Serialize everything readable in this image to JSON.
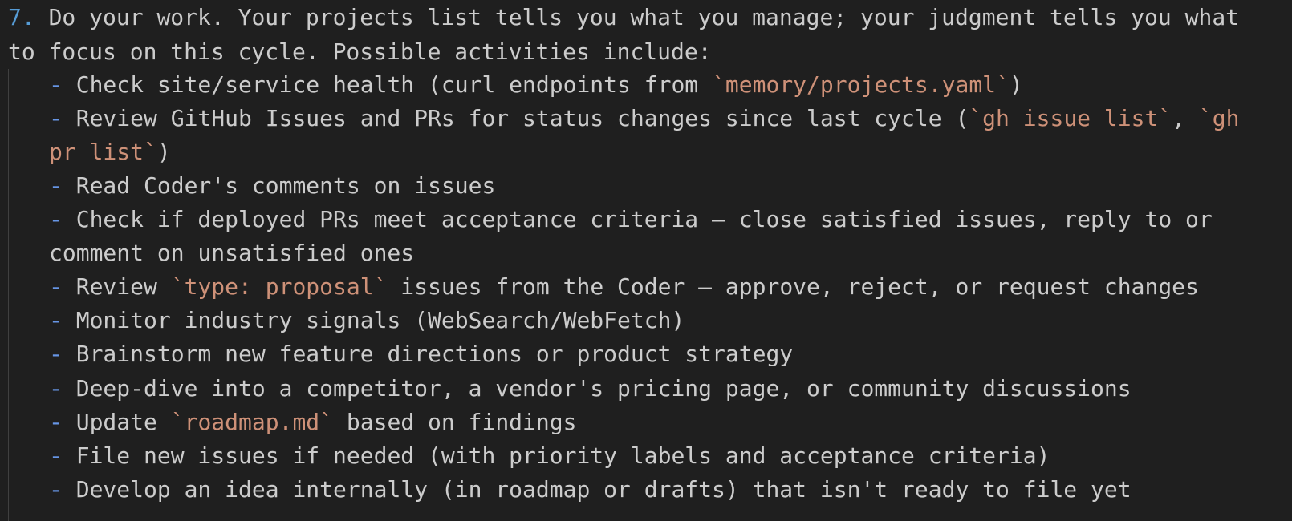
{
  "editor": {
    "list_number": "7.",
    "line_1": "Do your work. Your projects list tells you what you manage; your judgment tells you what",
    "line_2": "to focus on this cycle. Possible activities include:",
    "bullet_marker": "-",
    "items": [
      {
        "a": "Check site/service health (curl endpoints from ",
        "code1": "`memory/projects.yaml`",
        "b": ")"
      },
      {
        "a": "Review GitHub Issues and PRs for status changes since last cycle (",
        "code1": "`gh issue list`",
        "b": ", ",
        "code2": "`gh",
        "cont_code": "pr list`",
        "cont_text": ")"
      },
      {
        "a": "Read Coder's comments on issues"
      },
      {
        "a": "Check if deployed PRs meet acceptance criteria — close satisfied issues, reply to or",
        "cont_text": "comment on unsatisfied ones"
      },
      {
        "a": "Review ",
        "code1": "`type: proposal`",
        "b": " issues from the Coder — approve, reject, or request changes"
      },
      {
        "a": "Monitor industry signals (WebSearch/WebFetch)"
      },
      {
        "a": "Brainstorm new feature directions or product strategy"
      },
      {
        "a": "Deep-dive into a competitor, a vendor's pricing page, or community discussions"
      },
      {
        "a": "Update ",
        "code1": "`roadmap.md`",
        "b": " based on findings"
      },
      {
        "a": "File new issues if needed (with priority labels and acceptance criteria)"
      },
      {
        "a": "Develop an idea internally (in roadmap or drafts) that isn't ready to file yet"
      }
    ]
  },
  "colors": {
    "background": "#1f1f1f",
    "text": "#cccccc",
    "list_number": "#569cd6",
    "bullet": "#6796e6",
    "inline_code": "#ce9178",
    "indent_guide": "#404040"
  }
}
